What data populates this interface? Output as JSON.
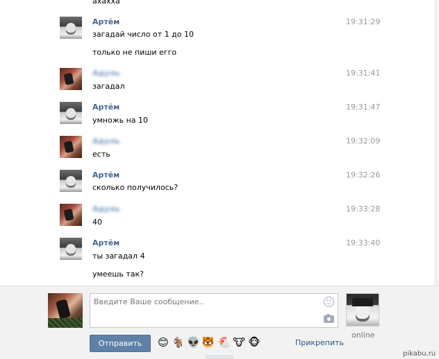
{
  "chat": {
    "top_cut_text": "ахахха",
    "messages": [
      {
        "author": "Артём",
        "avatar": "artem",
        "blurred": false,
        "time": "19:31:29",
        "lines": [
          "загадай число от 1 до 10",
          "только не пиши егго"
        ]
      },
      {
        "author": "Адуль",
        "avatar": "ad",
        "blurred": true,
        "time": "19:31:41",
        "lines": [
          "загадал"
        ]
      },
      {
        "author": "Артём",
        "avatar": "artem",
        "blurred": false,
        "time": "19:31:47",
        "lines": [
          "умножь на 10"
        ]
      },
      {
        "author": "Адуль",
        "avatar": "ad",
        "blurred": true,
        "time": "19:32:09",
        "lines": [
          "есть"
        ]
      },
      {
        "author": "Артём",
        "avatar": "artem",
        "blurred": false,
        "time": "19:32:26",
        "lines": [
          "сколько получилось?"
        ]
      },
      {
        "author": "Адуль",
        "avatar": "ad",
        "blurred": true,
        "time": "19:33:28",
        "lines": [
          "40"
        ]
      },
      {
        "author": "Артём",
        "avatar": "artem",
        "blurred": false,
        "time": "19:33:40",
        "lines": [
          "ты загадал 4",
          "умеешь так?"
        ]
      }
    ]
  },
  "composer": {
    "placeholder": "Введите Ваше сообщение..",
    "send_label": "Отправить",
    "attach_label": "Прикрепить",
    "emojis": [
      "😊",
      "🐐",
      "👽",
      "🐯",
      "🐔",
      "🐮",
      "🐵"
    ],
    "peer_status": "online"
  },
  "watermark": "pikabu.ru",
  "icons": {
    "smile": "smile-icon",
    "camera": "camera-icon"
  },
  "colors": {
    "name_link": "#45688e",
    "button": "#5e81a8",
    "time": "#999999"
  }
}
